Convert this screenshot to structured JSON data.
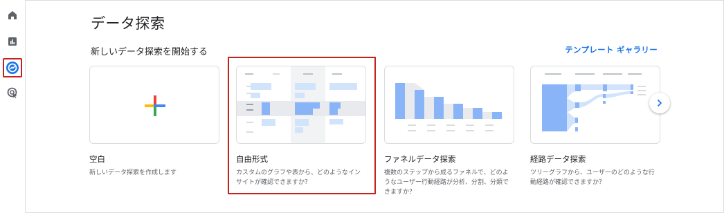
{
  "sidebar": {
    "items": [
      {
        "icon": "home-icon",
        "label": ""
      },
      {
        "icon": "reports-icon",
        "label": ""
      },
      {
        "icon": "explore-icon",
        "label": "",
        "active": true
      },
      {
        "icon": "advertising-icon",
        "label": ""
      }
    ]
  },
  "page": {
    "title": "データ探索",
    "section_title": "新しいデータ探索を開始する",
    "gallery_link": "テンプレート ギャラリー"
  },
  "cards": [
    {
      "title": "空白",
      "desc": "新しいデータ探索を作成します"
    },
    {
      "title": "自由形式",
      "desc": "カスタムのグラフや表から、どのようなインサイトが確認できますか？"
    },
    {
      "title": "ファネルデータ探索",
      "desc": "複数のステップから成るファネルで、どのようなユーザー行動経路が分析、分割、分類できますか？"
    },
    {
      "title": "経路データ探索",
      "desc": "ツリーグラフから、ユーザーのどのような行動経路が確認できますか？"
    }
  ],
  "colors": {
    "accent": "#1a73e8",
    "selection": "#c5221f",
    "bar_blue": "#8ab4f8",
    "bar_light": "#d2e3fc"
  }
}
